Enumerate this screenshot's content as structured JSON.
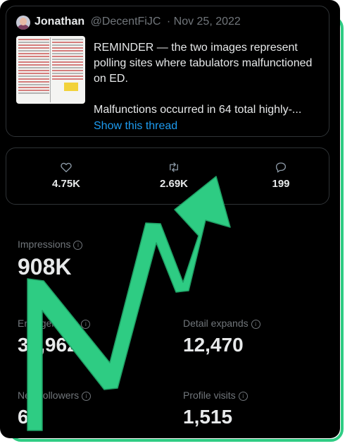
{
  "tweet": {
    "author_name": "Jonathan",
    "author_handle": "@DecentFiJC",
    "date": "· Nov 25, 2022",
    "text_line1": "REMINDER — the two images represent polling sites where tabulators malfunctioned on ED.",
    "text_line2": "Malfunctions occurred in 64 total highly-...",
    "show_thread": "Show this thread"
  },
  "engagement": {
    "likes": "4.75K",
    "retweets": "2.69K",
    "replies": "199"
  },
  "analytics": {
    "impressions_label": "Impressions",
    "impressions_value": "908K",
    "engagements_label": "Engagements",
    "engagements_value": "30,962",
    "detail_expands_label": "Detail expands",
    "detail_expands_value": "12,470",
    "new_followers_label": "New followers",
    "new_followers_value": "60",
    "profile_visits_label": "Profile visits",
    "profile_visits_value": "1,515"
  },
  "colors": {
    "accent_green": "#2ecc83",
    "link_blue": "#1d9bf0",
    "background": "#000000",
    "muted_text": "#71767b"
  },
  "icons": [
    "heart-icon",
    "retweet-icon",
    "reply-icon",
    "info-icon",
    "upward-trend-arrow-icon"
  ]
}
